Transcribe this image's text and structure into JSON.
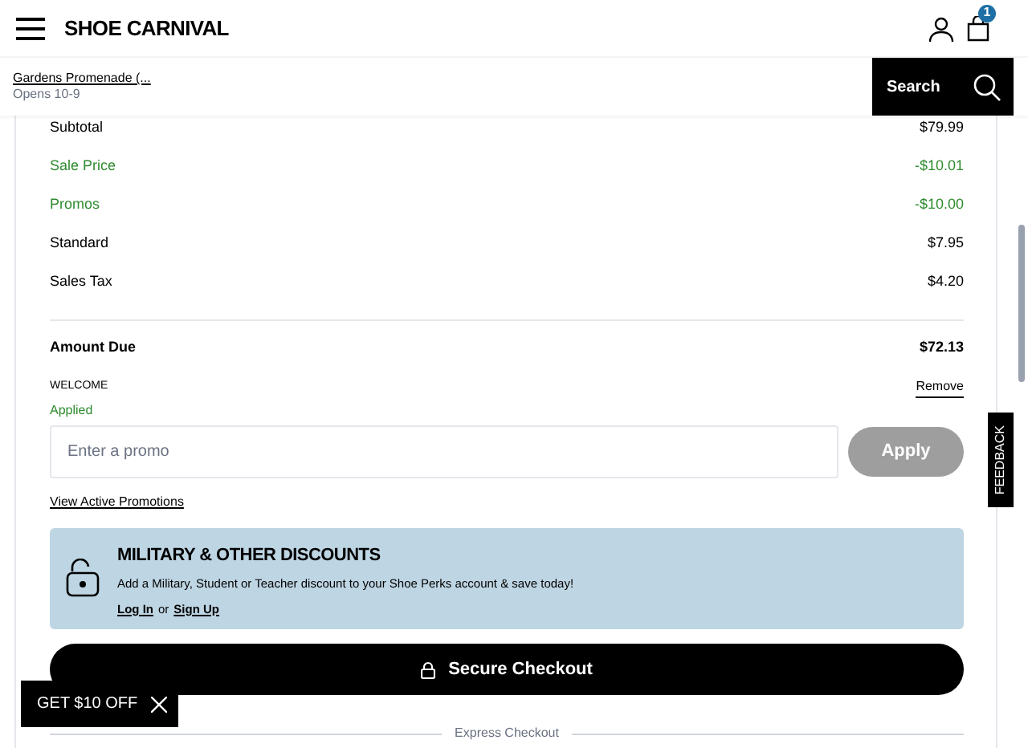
{
  "header": {
    "logo": "SHOE CARNIVAL",
    "cart_count": "1"
  },
  "store": {
    "name": "Gardens Promenade (...",
    "hours": "Opens 10-9"
  },
  "search": {
    "label": "Search"
  },
  "summary": [
    {
      "label": "Subtotal",
      "value": "$79.99",
      "kind": "charge"
    },
    {
      "label": "Sale Price",
      "value": "-$10.01",
      "kind": "discount"
    },
    {
      "label": "Promos",
      "value": "-$10.00",
      "kind": "discount"
    },
    {
      "label": "Standard",
      "value": "$7.95",
      "kind": "charge"
    },
    {
      "label": "Sales Tax",
      "value": "$4.20",
      "kind": "charge"
    }
  ],
  "amount_due": {
    "label": "Amount Due",
    "value": "$72.13"
  },
  "promo": {
    "code": "WELCOME",
    "remove": "Remove",
    "status": "Applied",
    "placeholder": "Enter a promo",
    "apply": "Apply",
    "apply_disabled": true,
    "link": "View Active Promotions"
  },
  "discounts": {
    "title": "MILITARY & OTHER DISCOUNTS",
    "text": "Add a Military, Student or Teacher discount to your Shoe Perks account & save today!",
    "login": "Log In",
    "or": "or",
    "signup": "Sign Up"
  },
  "checkout": {
    "label": "Secure Checkout"
  },
  "express": {
    "label": "Express Checkout"
  },
  "feedback": {
    "label": "FEEDBACK"
  },
  "offer": {
    "label": "GET $10 OFF"
  }
}
